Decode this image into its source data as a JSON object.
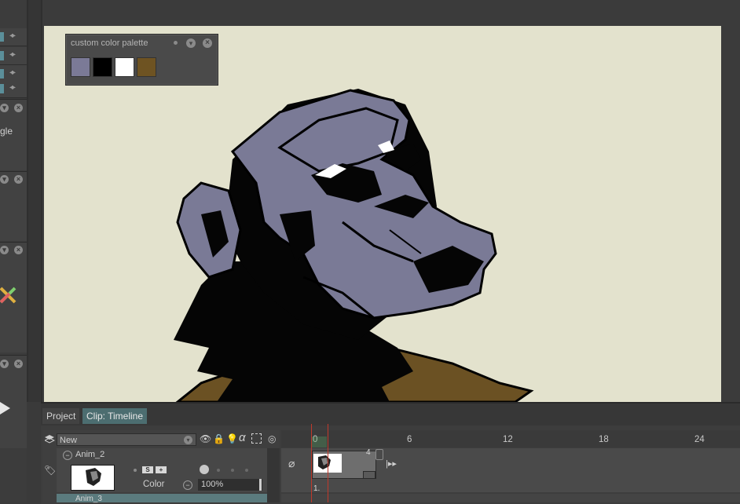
{
  "left_panel": {
    "partial_label": "gle"
  },
  "palette": {
    "title": "custom color palette",
    "swatches": [
      "#7b7a97",
      "#000000",
      "#ffffff",
      "#6e5322"
    ]
  },
  "tabs": {
    "project": "Project",
    "timeline": "Clip: Timeline"
  },
  "layers": {
    "new_label": "New",
    "layer1_name": "Anim_2",
    "color_label": "Color",
    "opacity": "100%",
    "layer2_name": "Anim_3"
  },
  "timeline": {
    "ticks": [
      "0",
      "6",
      "12",
      "18",
      "24"
    ],
    "clip_end_frame": "4",
    "marker": "1."
  },
  "colors": {
    "accent_tab": "#4c6d70",
    "playhead": "#c0392b",
    "canvas": "#e3e2cd"
  }
}
